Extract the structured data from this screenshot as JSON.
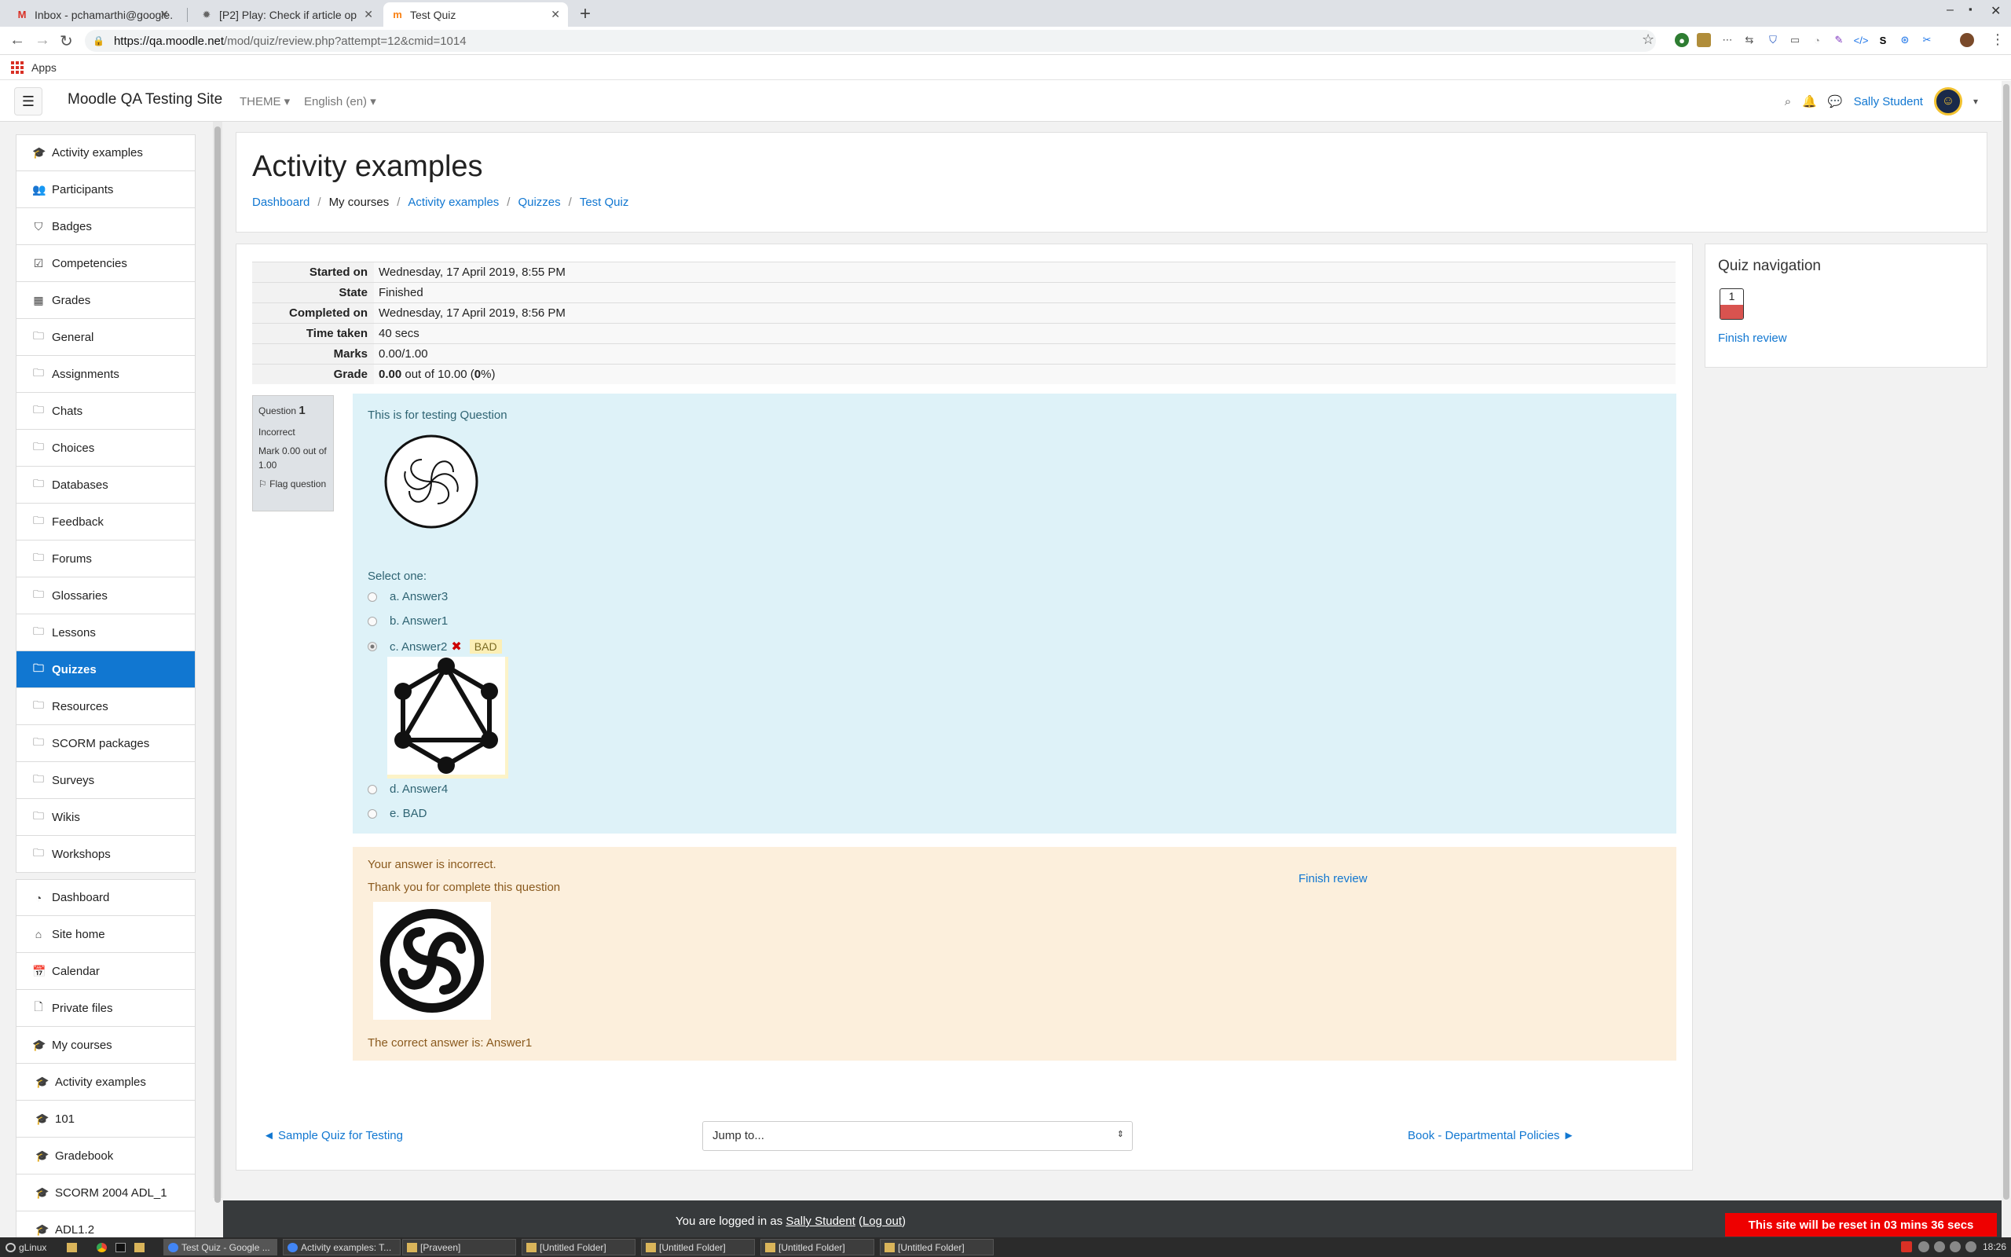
{
  "browser": {
    "tabs": [
      {
        "title": "Inbox - pchamarthi@google.",
        "icon": "gmail-icon"
      },
      {
        "title": "[P2] Play: Check if article op",
        "icon": "bug-icon"
      },
      {
        "title": "Test Quiz",
        "icon": "moodle-icon"
      }
    ],
    "url_host": "https://qa.moodle.net",
    "url_path": "/mod/quiz/review.php?attempt=12&cmid=1014",
    "bookmarks_apps": "Apps"
  },
  "navbar": {
    "site_name": "Moodle QA Testing Site",
    "theme": "THEME",
    "language": "English (en)",
    "user_name": "Sally Student"
  },
  "drawer": {
    "items": [
      {
        "label": "Activity examples",
        "icon": "graduation-cap-icon"
      },
      {
        "label": "Participants",
        "icon": "users-icon"
      },
      {
        "label": "Badges",
        "icon": "shield-icon"
      },
      {
        "label": "Competencies",
        "icon": "checkbox-icon"
      },
      {
        "label": "Grades",
        "icon": "table-icon"
      },
      {
        "label": "General",
        "icon": "folder-icon"
      },
      {
        "label": "Assignments",
        "icon": "folder-icon"
      },
      {
        "label": "Chats",
        "icon": "folder-icon"
      },
      {
        "label": "Choices",
        "icon": "folder-icon"
      },
      {
        "label": "Databases",
        "icon": "folder-icon"
      },
      {
        "label": "Feedback",
        "icon": "folder-icon"
      },
      {
        "label": "Forums",
        "icon": "folder-icon"
      },
      {
        "label": "Glossaries",
        "icon": "folder-icon"
      },
      {
        "label": "Lessons",
        "icon": "folder-icon"
      },
      {
        "label": "Quizzes",
        "icon": "folder-icon",
        "active": true
      },
      {
        "label": "Resources",
        "icon": "folder-icon"
      },
      {
        "label": "SCORM packages",
        "icon": "folder-icon"
      },
      {
        "label": "Surveys",
        "icon": "folder-icon"
      },
      {
        "label": "Wikis",
        "icon": "folder-icon"
      },
      {
        "label": "Workshops",
        "icon": "folder-icon"
      }
    ],
    "items2": [
      {
        "label": "Dashboard",
        "icon": "dashboard-icon"
      },
      {
        "label": "Site home",
        "icon": "home-icon"
      },
      {
        "label": "Calendar",
        "icon": "calendar-icon"
      },
      {
        "label": "Private files",
        "icon": "file-icon"
      },
      {
        "label": "My courses",
        "icon": "graduation-cap-icon"
      },
      {
        "label": "Activity examples",
        "icon": "graduation-cap-icon",
        "indent": true
      },
      {
        "label": "101",
        "icon": "graduation-cap-icon",
        "indent": true
      },
      {
        "label": "Gradebook",
        "icon": "graduation-cap-icon",
        "indent": true
      },
      {
        "label": "SCORM 2004 ADL_1",
        "icon": "graduation-cap-icon",
        "indent": true
      },
      {
        "label": "ADL1.2",
        "icon": "graduation-cap-icon",
        "indent": true
      }
    ]
  },
  "header": {
    "title": "Activity examples",
    "breadcrumb": [
      "Dashboard",
      "My courses",
      "Activity examples",
      "Quizzes",
      "Test Quiz"
    ]
  },
  "summary": [
    {
      "label": "Started on",
      "value": "Wednesday, 17 April 2019, 8:55 PM"
    },
    {
      "label": "State",
      "value": "Finished"
    },
    {
      "label": "Completed on",
      "value": "Wednesday, 17 April 2019, 8:56 PM"
    },
    {
      "label": "Time taken",
      "value": "40 secs"
    },
    {
      "label": "Marks",
      "value": "0.00/1.00"
    }
  ],
  "grade": {
    "label": "Grade",
    "score": "0.00",
    "middle": " out of 10.00 (",
    "percent": "0",
    "end": "%)"
  },
  "question": {
    "label": "Question",
    "number": "1",
    "state": "Incorrect",
    "mark": "Mark 0.00 out of 1.00",
    "flag": "Flag question",
    "text": "This is for testing Question",
    "prompt": "Select one:",
    "choices": [
      {
        "label": "a. Answer3",
        "selected": false
      },
      {
        "label": "b. Answer1",
        "selected": false
      },
      {
        "label": "c. Answer2",
        "selected": true,
        "tag": "BAD"
      },
      {
        "label": "d. Answer4",
        "selected": false
      },
      {
        "label": "e. BAD",
        "selected": false
      }
    ]
  },
  "feedback": {
    "incorrect": "Your answer is incorrect.",
    "general": "Thank you for complete this question",
    "correct": "The correct answer is: Answer1"
  },
  "bottom_nav": {
    "prev": "◄ Sample Quiz for Testing",
    "jump": "Jump to...",
    "next": "Book - Departmental Policies ►",
    "finish": "Finish review"
  },
  "quiz_nav": {
    "title": "Quiz navigation",
    "button": "1",
    "finish": "Finish review"
  },
  "footer": {
    "logged_in": "You are logged in as ",
    "user": "Sally Student",
    "logout": "Log out",
    "reset": "This site will be reset in 03 mins 36 secs"
  },
  "taskbar": {
    "start": "gLinux",
    "tasks": [
      "Test Quiz - Google ...",
      "Activity examples: T...",
      "[Praveen]",
      "[Untitled Folder]",
      "[Untitled Folder]",
      "[Untitled Folder]",
      "[Untitled Folder]"
    ],
    "clock": "18:26"
  },
  "colors": {
    "accent": "#1177d1",
    "incorrect": "#d9534f",
    "question_bg": "#def2f8",
    "feedback_bg": "#fcefdc"
  }
}
